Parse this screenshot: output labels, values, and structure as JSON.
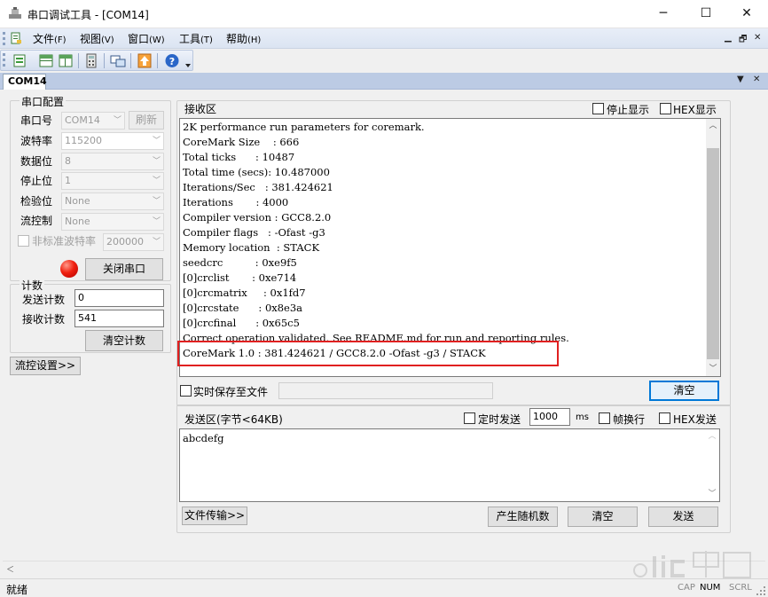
{
  "window": {
    "title": "串口调试工具 - [COM14]",
    "minimize": "─",
    "maximize": "☐",
    "close": "✕"
  },
  "menu": {
    "items": [
      {
        "label": "文件",
        "key": "(F)"
      },
      {
        "label": "视图",
        "key": "(V)"
      },
      {
        "label": "窗口",
        "key": "(W)"
      },
      {
        "label": "工具",
        "key": "(T)"
      },
      {
        "label": "帮助",
        "key": "(H)"
      }
    ],
    "mdi_min": "▁",
    "mdi_restore": "🗗",
    "mdi_close": "✕"
  },
  "toolbar": {
    "icons": [
      "new-connection-icon",
      "split-horizontal-icon",
      "split-vertical-icon",
      "calculator-icon",
      "screen-icon",
      "upload-icon",
      "help-icon"
    ]
  },
  "tab": {
    "label": "COM14",
    "dropdown": "▼",
    "close": "✕"
  },
  "serial_config": {
    "title": "串口配置",
    "port_label": "串口号",
    "port_value": "COM14",
    "refresh_label": "刷新",
    "baud_label": "波特率",
    "baud_value": "115200",
    "databits_label": "数据位",
    "databits_value": "8",
    "stopbits_label": "停止位",
    "stopbits_value": "1",
    "parity_label": "检验位",
    "parity_value": "None",
    "flow_label": "流控制",
    "flow_value": "None",
    "nonstandard_label": "非标准波特率",
    "nonstandard_value": "200000",
    "close_port_label": "关闭串口"
  },
  "counter": {
    "title": "计数",
    "sent_label": "发送计数",
    "sent_value": "0",
    "recv_label": "接收计数",
    "recv_value": "541",
    "clear_label": "清空计数"
  },
  "flow_settings_label": "流控设置>>",
  "receive": {
    "title": "接收区",
    "stop_display_label": "停止显示",
    "hex_display_label": "HEX显示",
    "lines": [
      "2K performance run parameters for coremark.",
      "CoreMark Size    : 666",
      "Total ticks      : 10487",
      "Total time (secs): 10.487000",
      "Iterations/Sec   : 381.424621",
      "Iterations       : 4000",
      "Compiler version : GCC8.2.0",
      "Compiler flags   : -Ofast -g3",
      "Memory location  : STACK",
      "seedcrc          : 0xe9f5",
      "[0]crclist       : 0xe714",
      "[0]crcmatrix     : 0x1fd7",
      "[0]crcstate      : 0x8e3a",
      "[0]crcfinal      : 0x65c5",
      "Correct operation validated. See README.md for run and reporting rules.",
      "CoreMark 1.0 : 381.424621 / GCC8.2.0 -Ofast -g3 / STACK"
    ],
    "save_label": "实时保存至文件",
    "save_path": "",
    "clear_label": "清空"
  },
  "send": {
    "title": "发送区(字节<64KB)",
    "timed_label": "定时发送",
    "interval_value": "1000",
    "interval_unit": "ms",
    "frame_newline_label": "帧换行",
    "hex_send_label": "HEX发送",
    "text": "abcdefg",
    "file_transfer_label": "文件传输>>",
    "random_label": "产生随机数",
    "clear_label": "清空",
    "send_label": "发送"
  },
  "status": {
    "text": "就绪",
    "cap": "CAP",
    "num": "NUM",
    "scrl": "SCRL"
  },
  "colors": {
    "highlight_border": "#e02020",
    "focus_blue": "#0078d7",
    "led_red": "#f02010"
  }
}
